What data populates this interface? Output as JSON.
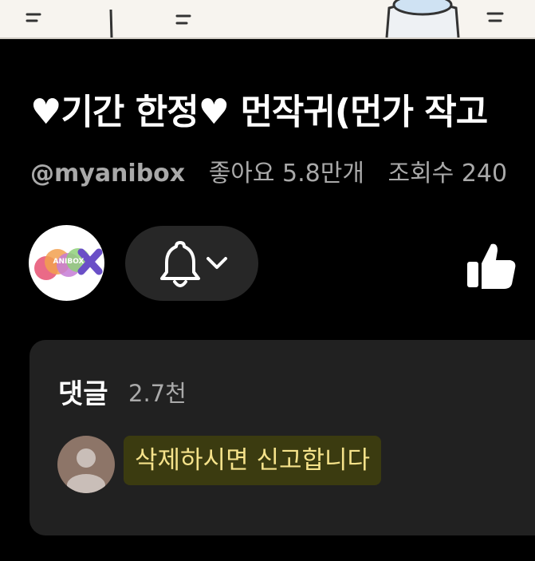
{
  "video": {
    "title": "♥기간 한정♥ 먼작귀(먼가 작고"
  },
  "channel": {
    "handle": "@myanibox",
    "likes": "좋아요 5.8만개",
    "views": "조회수 240",
    "logo_text": "ANIBOX"
  },
  "actions": {
    "bell_icon": "bell-icon",
    "chevron_icon": "chevron-down-icon",
    "like_icon": "thumbs-up-icon"
  },
  "comments": {
    "title": "댓글",
    "count": "2.7천",
    "top_comment": "삭제하시면 신고합니다"
  },
  "colors": {
    "background": "#000000",
    "card": "#212121",
    "button": "#272727",
    "highlight": "#3b3b10",
    "highlight_text": "#f5e28a"
  }
}
